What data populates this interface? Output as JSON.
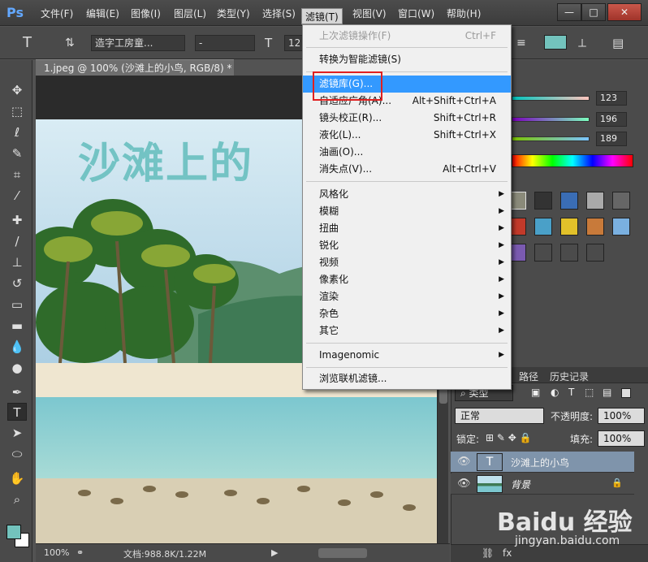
{
  "app": {
    "logo": "Ps"
  },
  "menubar": {
    "items": [
      "文件(F)",
      "编辑(E)",
      "图像(I)",
      "图层(L)",
      "类型(Y)",
      "选择(S)",
      "滤镜(T)",
      "视图(V)",
      "窗口(W)",
      "帮助(H)"
    ],
    "active": "滤镜(T)"
  },
  "window_controls": {
    "minimize": "—",
    "maximize": "□",
    "close": "✕"
  },
  "options_bar": {
    "tool_icon": "T",
    "font_family": "造字工房童...",
    "font_style": "-",
    "font_size": "12"
  },
  "document": {
    "tab_title": "1.jpeg @ 100% (沙滩上的小鸟, RGB/8) *",
    "overlay_text": "沙滩上的"
  },
  "status": {
    "zoom": "100%",
    "doc_info": "文档:988.8K/1.22M"
  },
  "color_panel": {
    "r": "123",
    "g": "196",
    "b": "189",
    "foreground": "#73c3bd"
  },
  "layers": {
    "tab_paths": "路径",
    "tab_history": "历史记录",
    "filter_kind": "类型",
    "blend_mode": "正常",
    "opacity_label": "不透明度:",
    "opacity_value": "100%",
    "lock_label": "锁定:",
    "fill_label": "填充:",
    "fill_value": "100%",
    "rows": [
      {
        "name": "沙滩上的小鸟",
        "type": "text",
        "thumb_icon": "T"
      },
      {
        "name": "背景",
        "type": "image"
      }
    ]
  },
  "filter_menu": {
    "items": [
      {
        "label": "上次滤镜操作(F)",
        "shortcut": "Ctrl+F",
        "disabled": true
      },
      {
        "label": "转换为智能滤镜(S)",
        "shortcut": ""
      },
      {
        "label": "滤镜库(G)...",
        "shortcut": "",
        "highlight": true
      },
      {
        "label": "自适应广角(A)...",
        "shortcut": "Alt+Shift+Ctrl+A"
      },
      {
        "label": "镜头校正(R)...",
        "shortcut": "Shift+Ctrl+R"
      },
      {
        "label": "液化(L)...",
        "shortcut": "Shift+Ctrl+X"
      },
      {
        "label": "油画(O)...",
        "shortcut": ""
      },
      {
        "label": "消失点(V)...",
        "shortcut": "Alt+Ctrl+V"
      },
      {
        "label": "风格化",
        "submenu": true
      },
      {
        "label": "模糊",
        "submenu": true
      },
      {
        "label": "扭曲",
        "submenu": true
      },
      {
        "label": "锐化",
        "submenu": true
      },
      {
        "label": "视频",
        "submenu": true
      },
      {
        "label": "像素化",
        "submenu": true
      },
      {
        "label": "渲染",
        "submenu": true
      },
      {
        "label": "杂色",
        "submenu": true
      },
      {
        "label": "其它",
        "submenu": true
      },
      {
        "label": "Imagenomic",
        "submenu": true
      },
      {
        "label": "浏览联机滤镜..."
      }
    ]
  },
  "watermark": {
    "logo": "Baidu 经验",
    "url": "jingyan.baidu.com"
  }
}
